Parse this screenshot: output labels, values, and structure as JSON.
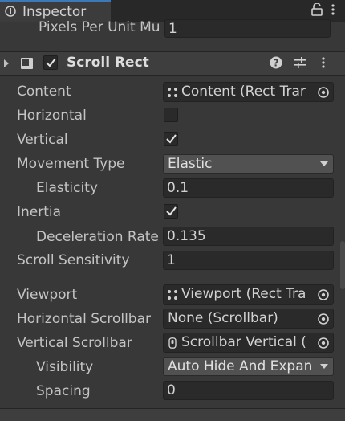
{
  "window": {
    "tab_title": "Inspector"
  },
  "top_field": {
    "label": "Pixels Per Unit Mu",
    "value": "1"
  },
  "component": {
    "name": "Scroll Rect",
    "enabled": true
  },
  "rows": {
    "content": {
      "label": "Content",
      "value": "Content (Rect Trar"
    },
    "horizontal": {
      "label": "Horizontal",
      "checked": false
    },
    "vertical": {
      "label": "Vertical",
      "checked": true
    },
    "movement_type": {
      "label": "Movement Type",
      "value": "Elastic"
    },
    "elasticity": {
      "label": "Elasticity",
      "value": "0.1"
    },
    "inertia": {
      "label": "Inertia",
      "checked": true
    },
    "deceleration_rate": {
      "label": "Deceleration Rate",
      "value": "0.135"
    },
    "scroll_sensitivity": {
      "label": "Scroll Sensitivity",
      "value": "1"
    },
    "viewport": {
      "label": "Viewport",
      "value": "Viewport (Rect Tra"
    },
    "horizontal_scrollbar": {
      "label": "Horizontal Scrollbar",
      "value": "None (Scrollbar)"
    },
    "vertical_scrollbar": {
      "label": "Vertical Scrollbar",
      "value": "Scrollbar Vertical ("
    },
    "visibility": {
      "label": "Visibility",
      "value": "Auto Hide And Expan"
    },
    "spacing": {
      "label": "Spacing",
      "value": "0"
    }
  },
  "colors": {
    "accent": "#3a79bb",
    "background": "#383838",
    "field": "#2a2a2a"
  },
  "icons": [
    "inspector-icon",
    "lock-icon",
    "kebab-menu-icon",
    "component-icon",
    "help-icon",
    "preset-icon",
    "rect-transform-icon",
    "scrollbar-icon",
    "object-picker-icon"
  ]
}
